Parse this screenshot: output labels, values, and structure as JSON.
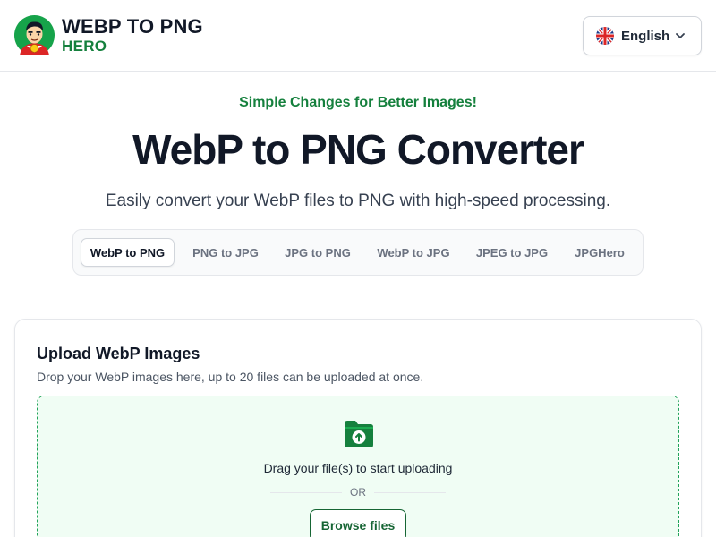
{
  "header": {
    "logo_line1": "WEBP TO PNG",
    "logo_line2": "HERO",
    "language": {
      "label": "English",
      "flag_icon": "uk-flag-icon",
      "chevron_icon": "chevron-down-icon"
    }
  },
  "hero": {
    "tagline": "Simple Changes for Better Images!",
    "title": "WebP to PNG Converter",
    "subtitle": "Easily convert your WebP files to PNG with high-speed processing."
  },
  "tabs": [
    {
      "label": "WebP to PNG",
      "active": true
    },
    {
      "label": "PNG to JPG",
      "active": false
    },
    {
      "label": "JPG to PNG",
      "active": false
    },
    {
      "label": "WebP to JPG",
      "active": false
    },
    {
      "label": "JPEG to JPG",
      "active": false
    },
    {
      "label": "JPGHero",
      "active": false
    }
  ],
  "upload": {
    "title": "Upload WebP Images",
    "description": "Drop your WebP images here, up to 20 files can be uploaded at once.",
    "drag_text": "Drag your file(s) to start uploading",
    "or_text": "OR",
    "browse_label": "Browse files",
    "icon": "folder-upload-icon"
  },
  "colors": {
    "accent": "#15803d",
    "dropzone_bg": "#f0fdf4",
    "dropzone_border": "#22a35a",
    "text_dark": "#111827"
  }
}
